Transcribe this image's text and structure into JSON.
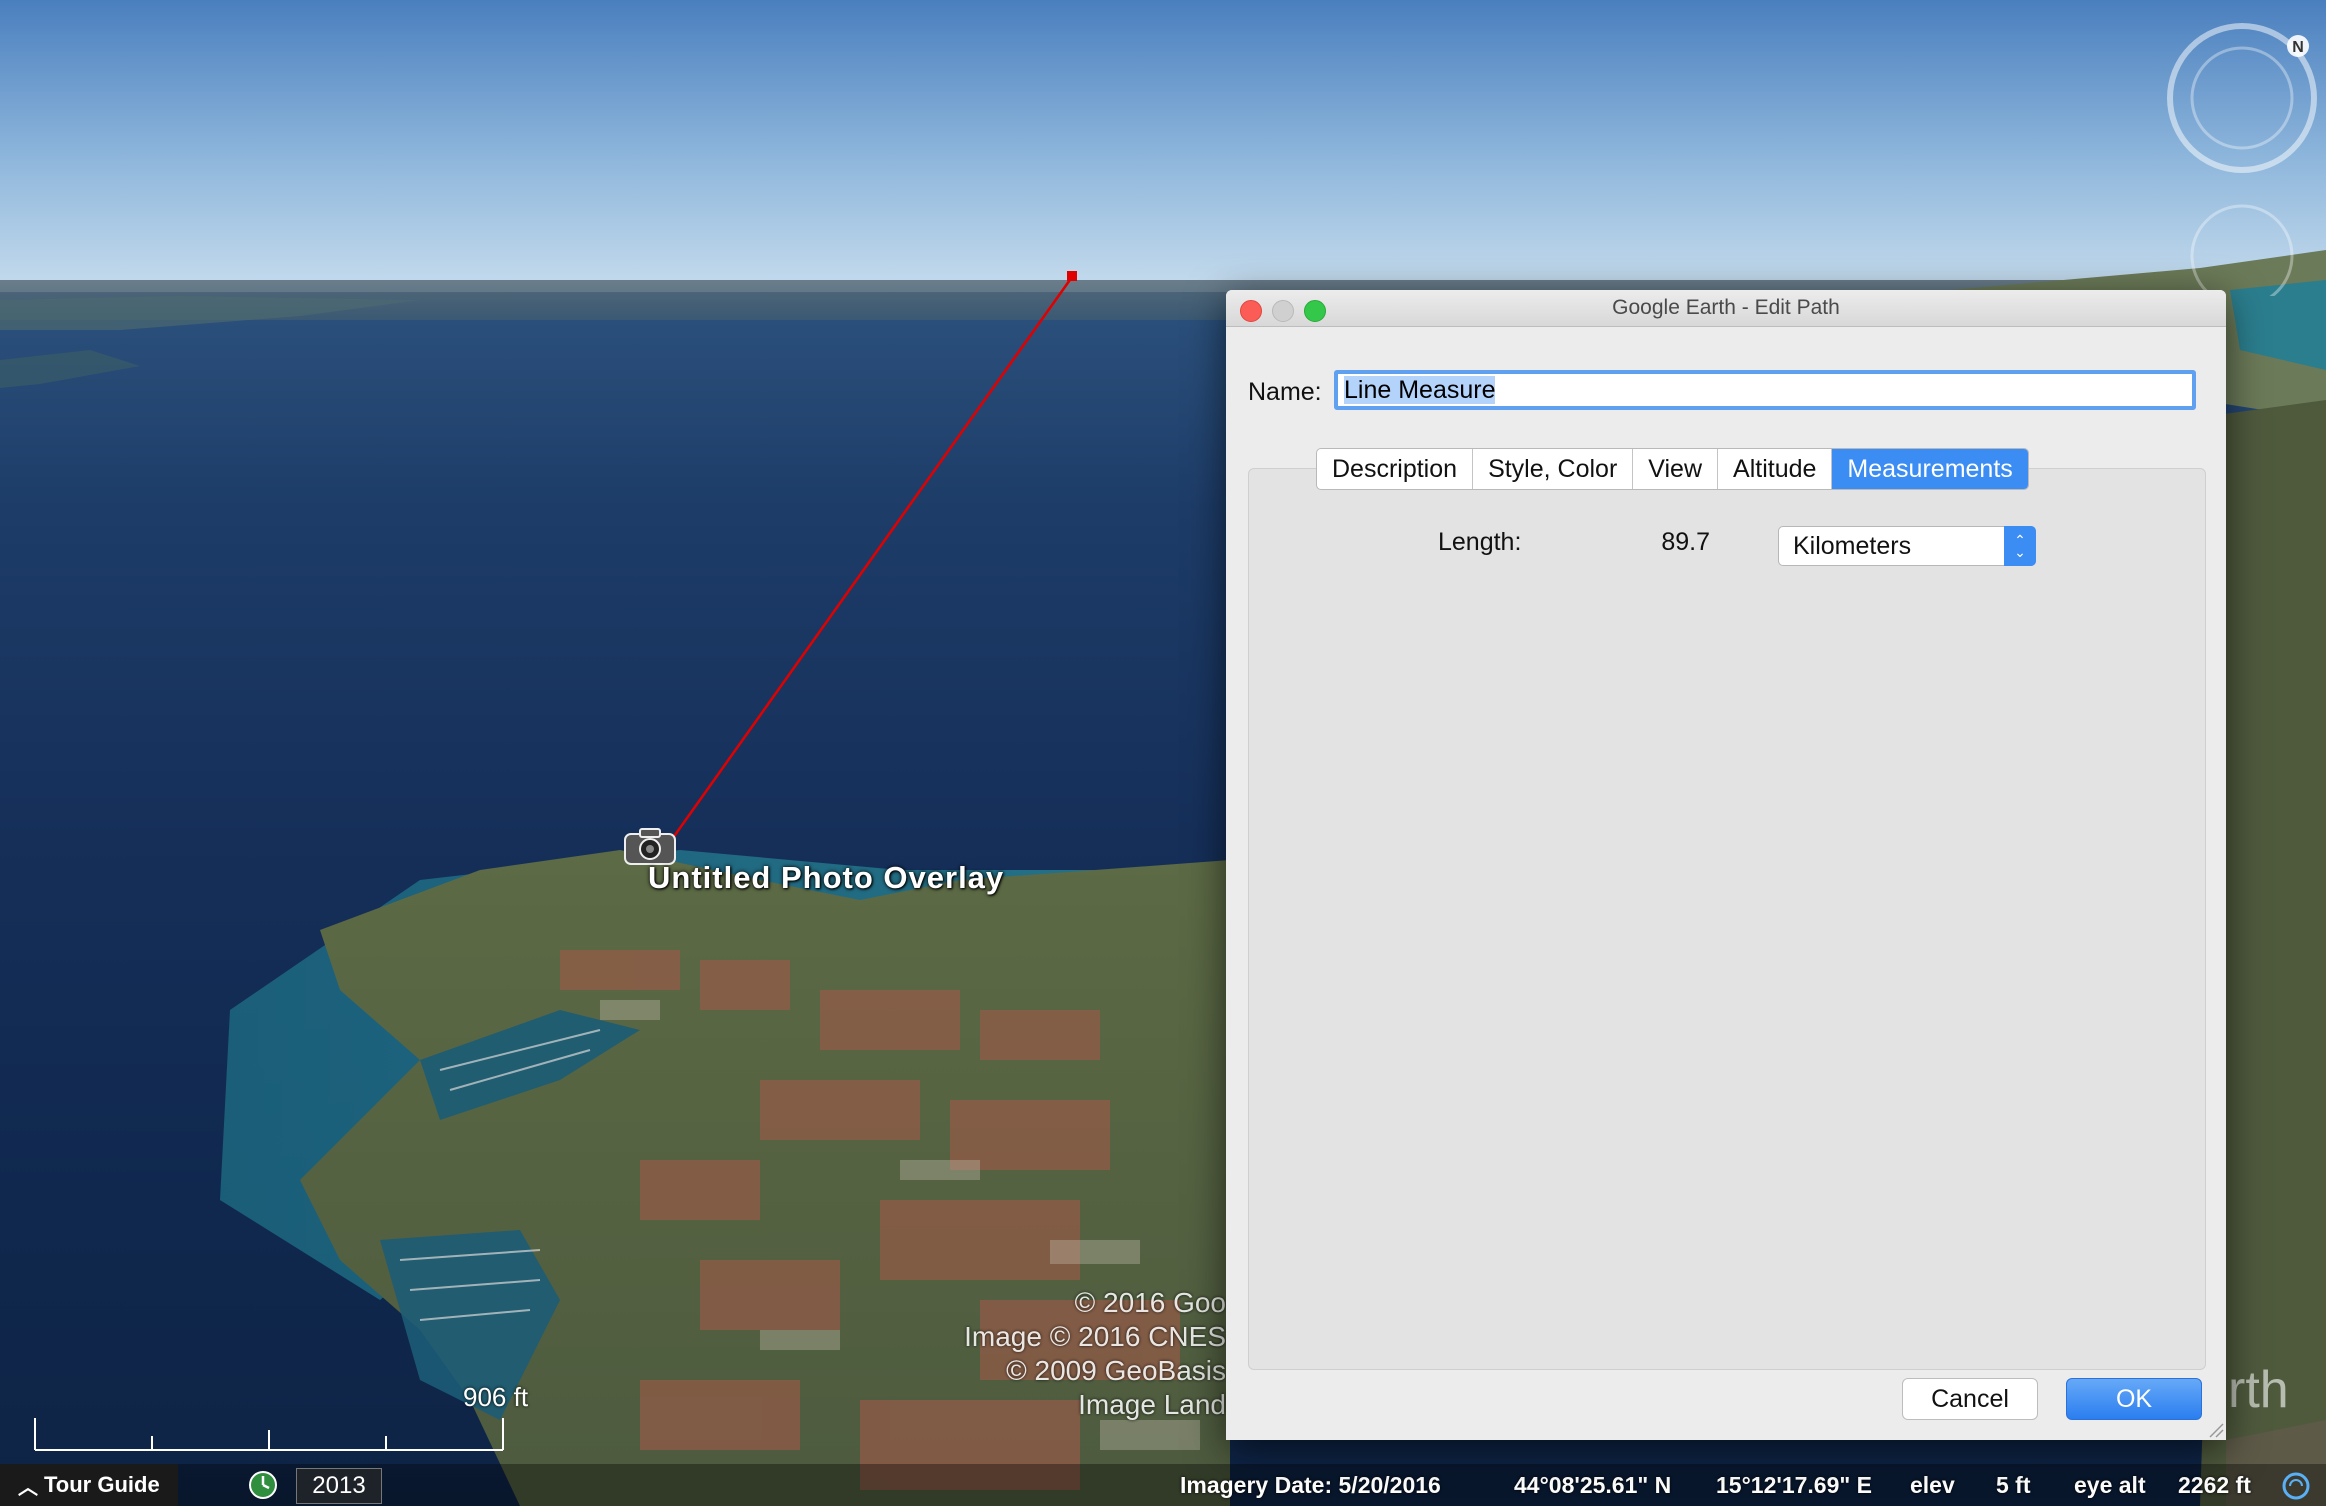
{
  "map": {
    "overlay_label": "Untitled Photo Overlay",
    "overlay_icon": "camera-icon",
    "copyright_lines": [
      "© 2016 Goo",
      "Image © 2016 CNES",
      "© 2009 GeoBasis",
      "Image Land"
    ],
    "scale_label": "906 ft",
    "edge_text": "rth",
    "path_color": "#e00000"
  },
  "status_bar": {
    "tour_guide": "Tour Guide",
    "year": "2013",
    "imagery_date": "Imagery Date: 5/20/2016",
    "latitude": "44°08'25.61\" N",
    "longitude": "15°12'17.69\" E",
    "elev_label": "elev",
    "elev_value": "5 ft",
    "eye_alt_label": "eye alt",
    "eye_alt_value": "2262 ft"
  },
  "dialog": {
    "title": "Google Earth - Edit Path",
    "name_label": "Name:",
    "name_value": "Line Measure",
    "tabs": [
      "Description",
      "Style, Color",
      "View",
      "Altitude",
      "Measurements"
    ],
    "active_tab": "Measurements",
    "length_label": "Length:",
    "length_value": "89.7",
    "unit_selected": "Kilometers",
    "cancel_label": "Cancel",
    "ok_label": "OK",
    "accent_color": "#3b8df3"
  }
}
